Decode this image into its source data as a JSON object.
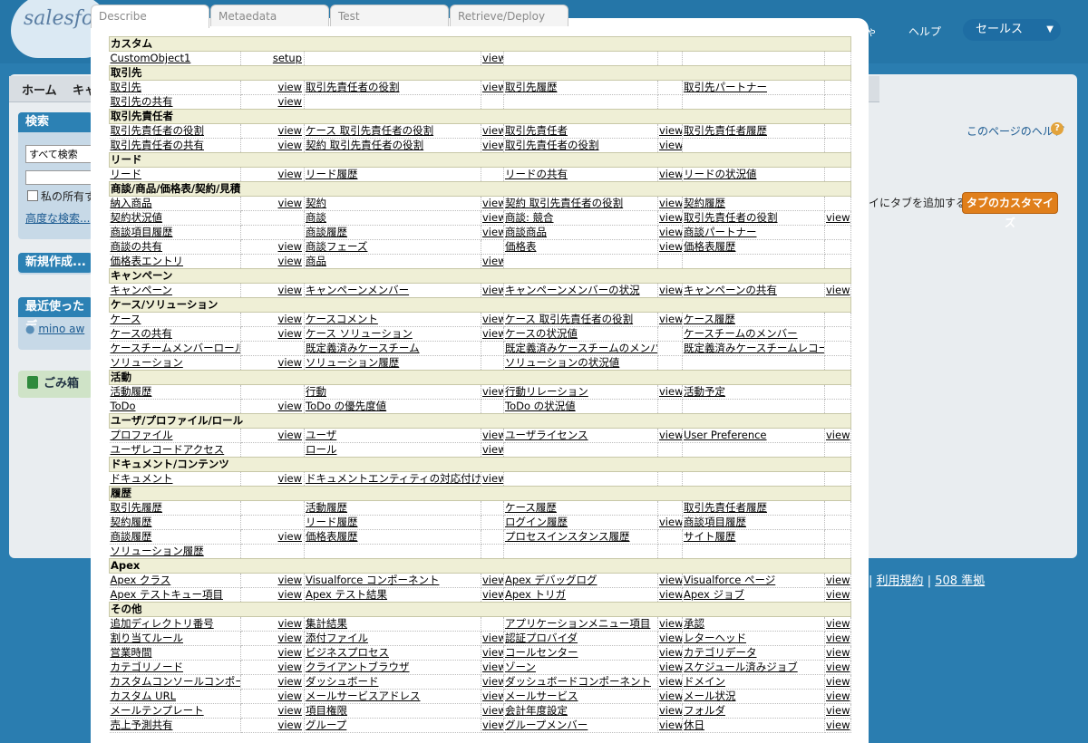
{
  "background": {
    "logo_text": "salesforce",
    "nav_items": [
      "ヘルプ"
    ],
    "nav_partial": "ゃ",
    "app_selector": "セールス",
    "tabs": [
      "ホーム",
      "キャ"
    ],
    "sidebar": {
      "search_title": "検索",
      "search_scope": "すべて検索",
      "mine_only": "私の所有す",
      "advanced_search": "高度な検索...",
      "new_create": "新規作成...",
      "recent_title": "最近使ったデ",
      "recent_user": "mino aw",
      "trash": "ごみ箱"
    },
    "help_link": "このページのヘルプ",
    "tab_add_text": "イにタブを追加する",
    "customize_button": "タブのカスタマイズ",
    "footer": [
      "|",
      "利用規約",
      "|",
      "508 準拠"
    ]
  },
  "dialog": {
    "tabs": [
      "Describe",
      "Metaedata",
      "Test",
      "Retrieve/Deploy"
    ],
    "active_tab": "Describe"
  },
  "sections": [
    {
      "title": "カスタム",
      "rows": [
        [
          [
            "CustomObject1",
            "setup"
          ],
          [
            "",
            "view"
          ]
        ]
      ]
    },
    {
      "title": "取引先",
      "rows": [
        [
          [
            "取引先",
            "view"
          ],
          [
            "取引先責任者の役割",
            "view"
          ],
          [
            "取引先履歴",
            ""
          ],
          [
            "取引先パートナー",
            ""
          ]
        ],
        [
          [
            "取引先の共有",
            "view"
          ]
        ]
      ]
    },
    {
      "title": "取引先責任者",
      "rows": [
        [
          [
            "取引先責任者の役割",
            "view"
          ],
          [
            "ケース 取引先責任者の役割",
            "view"
          ],
          [
            "取引先責任者",
            "view"
          ],
          [
            "取引先責任者履歴",
            ""
          ]
        ],
        [
          [
            "取引先責任者の共有",
            "view"
          ],
          [
            "契約 取引先責任者の役割",
            "view"
          ],
          [
            "取引先責任者の役割",
            "view"
          ]
        ]
      ]
    },
    {
      "title": "リード",
      "rows": [
        [
          [
            "リード",
            "view"
          ],
          [
            "リード履歴",
            ""
          ],
          [
            "リードの共有",
            "view"
          ],
          [
            "リードの状況値",
            ""
          ]
        ]
      ]
    },
    {
      "title": "商談/商品/価格表/契約/見積",
      "rows": [
        [
          [
            "納入商品",
            "view"
          ],
          [
            "契約",
            "view"
          ],
          [
            "契約 取引先責任者の役割",
            "view"
          ],
          [
            "契約履歴",
            ""
          ]
        ],
        [
          [
            "契約状況値",
            ""
          ],
          [
            "商談",
            "view"
          ],
          [
            "商談: 競合",
            "view"
          ],
          [
            "取引先責任者の役割",
            "view"
          ]
        ],
        [
          [
            "商談項目履歴",
            ""
          ],
          [
            "商談履歴",
            "view"
          ],
          [
            "商談商品",
            "view"
          ],
          [
            "商談パートナー",
            ""
          ]
        ],
        [
          [
            "商談の共有",
            "view"
          ],
          [
            "商談フェーズ",
            ""
          ],
          [
            "価格表",
            "view"
          ],
          [
            "価格表履歴",
            ""
          ]
        ],
        [
          [
            "価格表エントリ",
            "view"
          ],
          [
            "商品",
            "view"
          ]
        ]
      ]
    },
    {
      "title": "キャンペーン",
      "rows": [
        [
          [
            "キャンペーン",
            "view"
          ],
          [
            "キャンペーンメンバー",
            "view"
          ],
          [
            "キャンペーンメンバーの状況",
            "view"
          ],
          [
            "キャンペーンの共有",
            "view"
          ]
        ]
      ]
    },
    {
      "title": "ケース/ソリューション",
      "rows": [
        [
          [
            "ケース",
            "view"
          ],
          [
            "ケースコメント",
            "view"
          ],
          [
            "ケース 取引先責任者の役割",
            "view"
          ],
          [
            "ケース履歴",
            ""
          ]
        ],
        [
          [
            "ケースの共有",
            "view"
          ],
          [
            "ケース ソリューション",
            "view"
          ],
          [
            "ケースの状況値",
            ""
          ],
          [
            "ケースチームのメンバー",
            ""
          ]
        ],
        [
          [
            "ケースチームメンバーロール",
            ""
          ],
          [
            "既定義済みケースチーム",
            ""
          ],
          [
            "既定義済みケースチームのメンバー",
            ""
          ],
          [
            "既定義済みケースチームレコード",
            ""
          ]
        ],
        [
          [
            "ソリューション",
            "view"
          ],
          [
            "ソリューション履歴",
            ""
          ],
          [
            "ソリューションの状況値",
            ""
          ]
        ]
      ]
    },
    {
      "title": "活動",
      "rows": [
        [
          [
            "活動履歴",
            ""
          ],
          [
            "行動",
            "view"
          ],
          [
            "行動リレーション",
            "view"
          ],
          [
            "活動予定",
            ""
          ]
        ],
        [
          [
            "ToDo",
            "view"
          ],
          [
            "ToDo の優先度値",
            ""
          ],
          [
            "ToDo の状況値",
            ""
          ]
        ]
      ]
    },
    {
      "title": "ユーザ/プロファイル/ロール",
      "rows": [
        [
          [
            "プロファイル",
            "view"
          ],
          [
            "ユーザ",
            "view"
          ],
          [
            "ユーザライセンス",
            "view"
          ],
          [
            "User Preference",
            "view"
          ]
        ],
        [
          [
            "ユーザレコードアクセス",
            ""
          ],
          [
            "ロール",
            "view"
          ]
        ]
      ]
    },
    {
      "title": "ドキュメント/コンテンツ",
      "rows": [
        [
          [
            "ドキュメント",
            "view"
          ],
          [
            "ドキュメントエンティティの対応付け",
            "view"
          ]
        ]
      ]
    },
    {
      "title": "履歴",
      "rows": [
        [
          [
            "取引先履歴",
            ""
          ],
          [
            "活動履歴",
            ""
          ],
          [
            "ケース履歴",
            ""
          ],
          [
            "取引先責任者履歴",
            ""
          ]
        ],
        [
          [
            "契約履歴",
            ""
          ],
          [
            "リード履歴",
            ""
          ],
          [
            "ログイン履歴",
            "view"
          ],
          [
            "商談項目履歴",
            ""
          ]
        ],
        [
          [
            "商談履歴",
            "view"
          ],
          [
            "価格表履歴",
            ""
          ],
          [
            "プロセスインスタンス履歴",
            ""
          ],
          [
            "サイト履歴",
            ""
          ]
        ],
        [
          [
            "ソリューション履歴",
            ""
          ]
        ]
      ]
    },
    {
      "title": "Apex",
      "rows": [
        [
          [
            "Apex クラス",
            "view"
          ],
          [
            "Visualforce コンポーネント",
            "view"
          ],
          [
            "Apex デバッグログ",
            "view"
          ],
          [
            "Visualforce ページ",
            "view"
          ]
        ],
        [
          [
            "Apex テストキュー項目",
            "view"
          ],
          [
            "Apex テスト結果",
            "view"
          ],
          [
            "Apex トリガ",
            "view"
          ],
          [
            "Apex ジョブ",
            "view"
          ]
        ]
      ]
    },
    {
      "title": "その他",
      "rows": [
        [
          [
            "追加ディレクトリ番号",
            "view"
          ],
          [
            "集計結果",
            ""
          ],
          [
            "アプリケーションメニュー項目",
            "view"
          ],
          [
            "承認",
            "view"
          ]
        ],
        [
          [
            "割り当てルール",
            "view"
          ],
          [
            "添付ファイル",
            "view"
          ],
          [
            "認証プロバイダ",
            "view"
          ],
          [
            "レターヘッド",
            "view"
          ]
        ],
        [
          [
            "営業時間",
            "view"
          ],
          [
            "ビジネスプロセス",
            "view"
          ],
          [
            "コールセンター",
            "view"
          ],
          [
            "カテゴリデータ",
            "view"
          ]
        ],
        [
          [
            "カテゴリノード",
            "view"
          ],
          [
            "クライアントブラウザ",
            "view"
          ],
          [
            "ゾーン",
            "view"
          ],
          [
            "スケジュール済みジョブ",
            "view"
          ]
        ],
        [
          [
            "カスタムコンソールコンポーネント",
            "view"
          ],
          [
            "ダッシュボード",
            "view"
          ],
          [
            "ダッシュボードコンポーネント",
            "view"
          ],
          [
            "ドメイン",
            "view"
          ]
        ],
        [
          [
            "カスタム URL",
            "view"
          ],
          [
            "メールサービスアドレス",
            "view"
          ],
          [
            "メールサービス",
            "view"
          ],
          [
            "メール状況",
            "view"
          ]
        ],
        [
          [
            "メールテンプレート",
            "view"
          ],
          [
            "項目権限",
            "view"
          ],
          [
            "会計年度設定",
            "view"
          ],
          [
            "フォルダ",
            "view"
          ]
        ],
        [
          [
            "売上予測共有",
            "view"
          ],
          [
            "グループ",
            "view"
          ],
          [
            "グループメンバー",
            "view"
          ],
          [
            "休日",
            "view"
          ]
        ]
      ]
    }
  ]
}
